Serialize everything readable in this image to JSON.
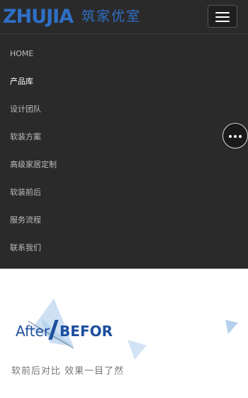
{
  "header": {
    "logo_latin": "ZHUJIA",
    "logo_cn": "筑家优室",
    "menu_icon": "hamburger-icon"
  },
  "nav": {
    "items": [
      {
        "label": "HOME",
        "active": false
      },
      {
        "label": "产品库",
        "active": true
      },
      {
        "label": "设计团队",
        "active": false
      },
      {
        "label": "软装方案",
        "active": false
      },
      {
        "label": "高级家居定制",
        "active": false
      },
      {
        "label": "软装前后",
        "active": false
      },
      {
        "label": "服务流程",
        "active": false
      },
      {
        "label": "联系我们",
        "active": false
      }
    ]
  },
  "float_button": {
    "icon": "more-dots-icon"
  },
  "section": {
    "title_after": "After",
    "title_before": "BEFOR",
    "subtitle": "软前后对比  效果一目了然"
  },
  "colors": {
    "header_bg": "#2a2a2a",
    "brand_blue": "#2f6fc6",
    "title_blue": "#1e4f9e",
    "deco_blue": "#b9d3ee"
  }
}
